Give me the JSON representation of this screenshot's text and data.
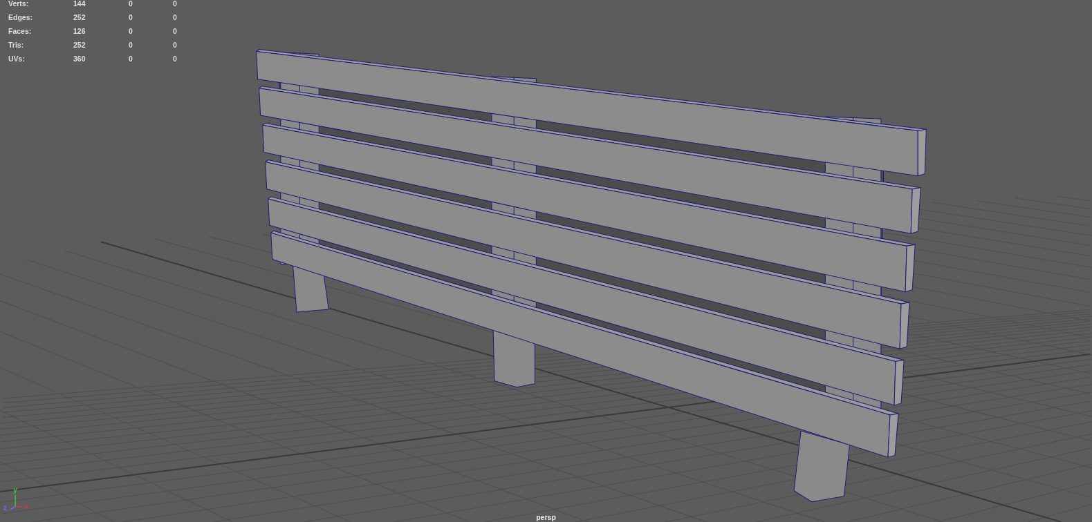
{
  "hud": {
    "rows": [
      {
        "label": "Verts:",
        "values": [
          "144",
          "0",
          "0"
        ]
      },
      {
        "label": "Edges:",
        "values": [
          "252",
          "0",
          "0"
        ]
      },
      {
        "label": "Faces:",
        "values": [
          "126",
          "0",
          "0"
        ]
      },
      {
        "label": "Tris:",
        "values": [
          "252",
          "0",
          "0"
        ]
      },
      {
        "label": "UVs:",
        "values": [
          "360",
          "0",
          "0"
        ]
      }
    ]
  },
  "viewport": {
    "camera": "persp",
    "axes": [
      {
        "label": "y",
        "color": "#3cc83c"
      },
      {
        "label": "z",
        "color": "#6070ff"
      },
      {
        "label": "x",
        "color": "#d23c3c"
      }
    ]
  }
}
